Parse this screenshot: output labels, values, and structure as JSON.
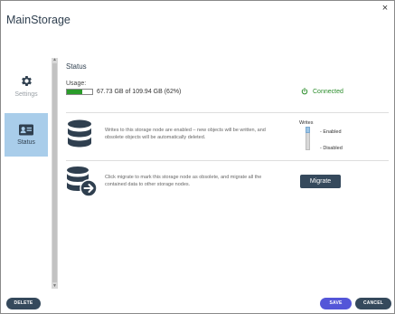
{
  "dialog": {
    "title": "MainStorage",
    "close_glyph": "×"
  },
  "sidebar": {
    "items": [
      {
        "label": "Settings",
        "icon": "gear-icon",
        "active": false
      },
      {
        "label": "Status",
        "icon": "id-card-icon",
        "active": true
      }
    ]
  },
  "status": {
    "section_title": "Status",
    "usage_label": "Usage:",
    "usage_text": "67.73 GB of 109.94 GB (62%)",
    "usage_fraction": 0.62,
    "connection": "Connected",
    "writes_description": "Writes to this storage node are enabled – new objects will be written, and obsolete objects will be automatically deleted.",
    "writes_label": "Writes",
    "writes_options": [
      "- Enabled",
      "- Disabled"
    ],
    "writes_selected": "- Enabled",
    "migrate_description": "Click migrate to mark this storage node as obsolete, and migrate all the contained data to other storage nodes.",
    "migrate_label": "Migrate"
  },
  "footer": {
    "delete_label": "DELETE",
    "save_label": "SAVE",
    "cancel_label": "CANCEL"
  },
  "colors": {
    "accent": "#35495c",
    "save": "#5456d8",
    "usage": "#2a9c2a",
    "sidebar_active": "#a9cdea"
  }
}
